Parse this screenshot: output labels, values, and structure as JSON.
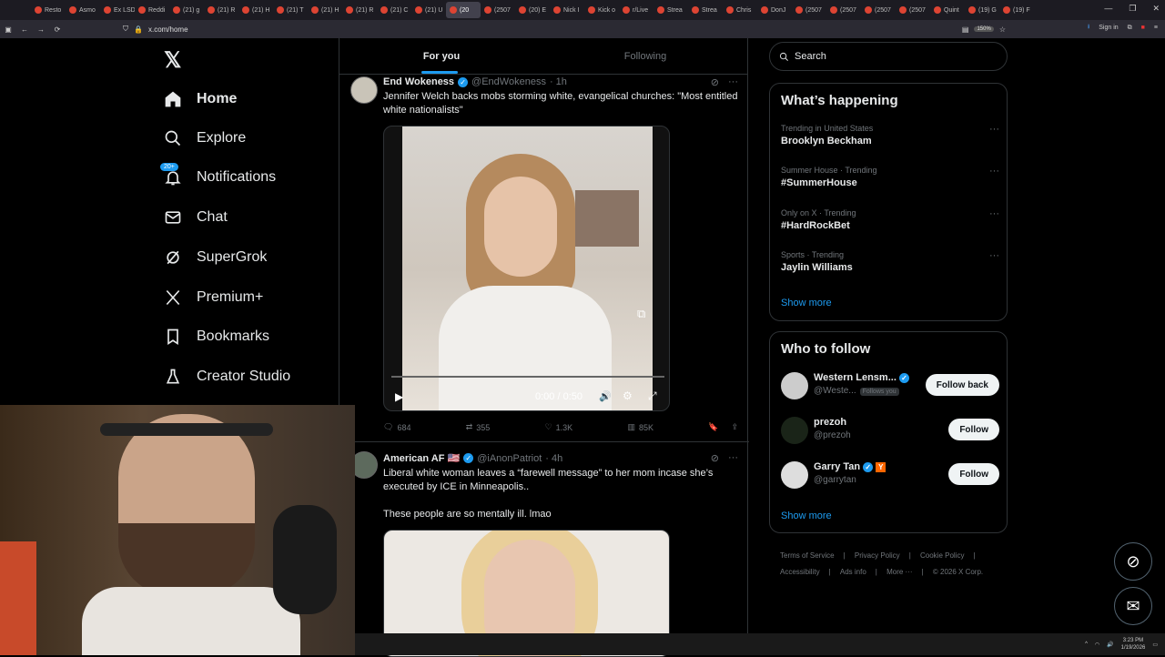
{
  "browser": {
    "tabs": [
      "Resto",
      "Asmo",
      "Ex LSD",
      "Reddi",
      "(21) g",
      "(21) R",
      "(21) H",
      "(21) T",
      "(21) H",
      "(21) R",
      "(21) C",
      "(21) U",
      "(20",
      "(2507",
      "(20) E",
      "Nick I",
      "Kick o",
      "r/Live",
      "Strea",
      "Strea",
      "Chris",
      "DonJ",
      "(2507",
      "(2507",
      "(2507",
      "(2507",
      "Quint",
      "(19) G",
      "(19) F"
    ],
    "active_tab_index": 12,
    "url": "x.com/home",
    "zoom": "150%",
    "sign_in": "Sign in"
  },
  "sidebar": {
    "items": [
      {
        "label": "Home",
        "icon": "home-icon"
      },
      {
        "label": "Explore",
        "icon": "search-icon"
      },
      {
        "label": "Notifications",
        "icon": "bell-icon",
        "badge": "20+"
      },
      {
        "label": "Chat",
        "icon": "mail-icon"
      },
      {
        "label": "SuperGrok",
        "icon": "grok-icon"
      },
      {
        "label": "Premium+",
        "icon": "x-logo-icon"
      },
      {
        "label": "Bookmarks",
        "icon": "bookmark-icon"
      },
      {
        "label": "Creator Studio",
        "icon": "flask-icon"
      }
    ]
  },
  "feed": {
    "tabs": [
      "For you",
      "Following"
    ],
    "tweets": [
      {
        "name": "End Wokeness",
        "handle": "@EndWokeness",
        "time": "· 1h",
        "text": "Jennifer Welch backs mobs storming white, evangelical churches: \"Most entitled white nationalists\"",
        "video_time": "0:00 / 0:50",
        "replies": "684",
        "reposts": "355",
        "likes": "1.3K",
        "views": "85K"
      },
      {
        "name": "American AF 🇺🇸",
        "handle": "@iAnonPatriot",
        "time": "· 4h",
        "text": "Liberal white woman leaves a “farewell message” to her mom incase she’s executed by ICE in Minneapolis..",
        "text2": "These people are so mentally ill. lmao"
      }
    ]
  },
  "right": {
    "search_placeholder": "Search",
    "happening_title": "What’s happening",
    "trends": [
      {
        "meta": "Trending in United States",
        "topic": "Brooklyn Beckham"
      },
      {
        "meta": "Summer House · Trending",
        "topic": "#SummerHouse"
      },
      {
        "meta": "Only on X · Trending",
        "topic": "#HardRockBet"
      },
      {
        "meta": "Sports · Trending",
        "topic": "Jaylin Williams"
      }
    ],
    "show_more": "Show more",
    "wtf_title": "Who to follow",
    "wtf": [
      {
        "name": "Western Lensm...",
        "handle": "@Weste...",
        "follows_you": "Follows you",
        "button": "Follow back"
      },
      {
        "name": "prezoh",
        "handle": "@prezoh",
        "button": "Follow"
      },
      {
        "name": "Garry Tan",
        "handle": "@garrytan",
        "button": "Follow"
      }
    ],
    "footer": [
      "Terms of Service",
      "Privacy Policy",
      "Cookie Policy",
      "Accessibility",
      "Ads info",
      "More ···",
      "© 2026 X Corp."
    ]
  },
  "taskbar": {
    "time": "3:23 PM",
    "date": "1/19/2026"
  }
}
